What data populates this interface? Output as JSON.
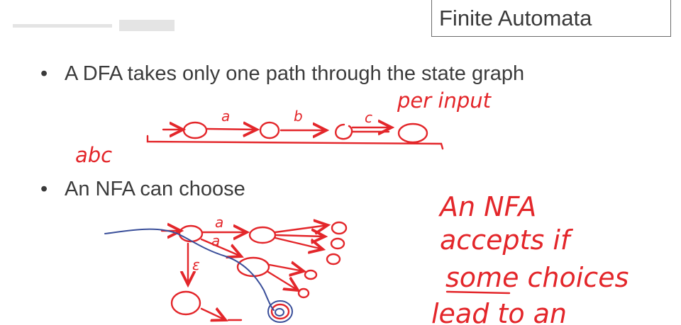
{
  "header": {
    "title": "Finite Automata"
  },
  "bullets": [
    "A DFA takes only one path through the state graph",
    "An NFA can choose"
  ],
  "bullet_symbol": "•",
  "annotations": {
    "per_input": "per input",
    "abc": "abc",
    "dfa_edge_labels": [
      "a",
      "b",
      "c"
    ],
    "nfa_edge_labels": [
      "a",
      "a",
      "ε"
    ],
    "note_lines": [
      "An NFA",
      "accepts if",
      "some choices",
      "lead to an"
    ]
  },
  "colors": {
    "ink_red": "#e3262a",
    "ink_blue": "#3a4f9a",
    "text": "#3b3b3b"
  }
}
